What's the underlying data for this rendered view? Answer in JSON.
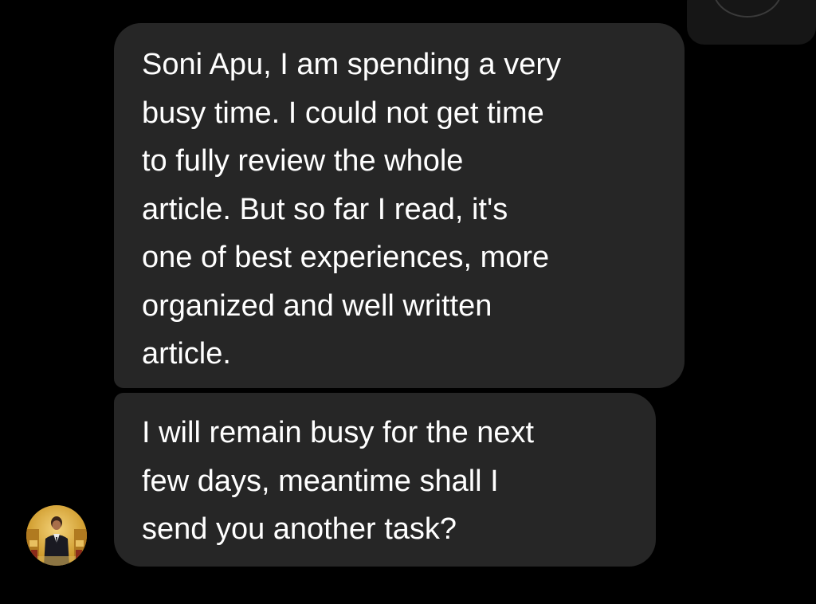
{
  "header": {
    "control_icon": "edit-icon"
  },
  "conversation": {
    "avatar_icon": "avatar-photo",
    "messages": [
      {
        "lines": [
          "Soni Apu, I am spending a very",
          "busy time. I could not get time",
          "to fully review the whole",
          "article. But so far I read, it's",
          "one of best experiences, more",
          "organized and well written",
          "article."
        ]
      },
      {
        "lines": [
          "I will remain busy for the next",
          "few days, meantime shall I",
          "send you another task?"
        ]
      }
    ]
  },
  "colors": {
    "background": "#000000",
    "bubble": "#262626",
    "text": "#ffffff"
  }
}
